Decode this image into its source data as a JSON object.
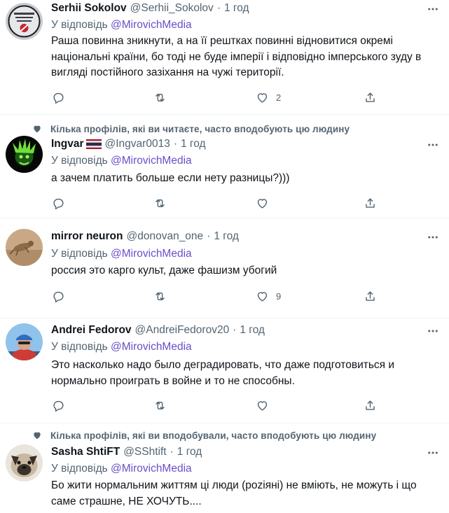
{
  "tweets": [
    {
      "social_context": "",
      "name": "Serhii Sokolov",
      "handle": "@Serhii_Sokolov",
      "time": "1 год",
      "reply_prefix": "У відповідь",
      "reply_mention": "@MirovichMedia",
      "text": "Раша повинна зникнути, а на її рештках повинні відновитися окремі національні країни, бо тоді не буде імперії і відповідно імперського зуду в вигляді постійного зазіхання на чужі території.",
      "reply_count": "",
      "retweet_count": "",
      "like_count": "2",
      "avatar_icon": "avatar-serhii"
    },
    {
      "social_context": "Кілька профілів, які ви читаєте, часто вподобують цю людину",
      "name": "Ingvar",
      "handle": "@Ingvar0013",
      "time": "1 год",
      "reply_prefix": "У відповідь",
      "reply_mention": "@MirovichMedia",
      "text": "а зачем платить больше если нету разницы?)))",
      "reply_count": "",
      "retweet_count": "",
      "like_count": "",
      "avatar_icon": "avatar-ingvar",
      "flag_icon": "thai-flag-icon"
    },
    {
      "social_context": "",
      "name": "mirror neuron",
      "handle": "@donovan_one",
      "time": "1 год",
      "reply_prefix": "У відповідь",
      "reply_mention": "@MirovichMedia",
      "text": "россия это карго культ, даже фашизм убогий",
      "reply_count": "",
      "retweet_count": "",
      "like_count": "9",
      "avatar_icon": "avatar-mirror"
    },
    {
      "social_context": "",
      "name": "Andrei Fedorov",
      "handle": "@AndreiFedorov20",
      "time": "1 год",
      "reply_prefix": "У відповідь",
      "reply_mention": "@MirovichMedia",
      "text": "Это насколько надо было деградировать, что даже подготовиться и нормально проиграть в войне и то не способны.",
      "reply_count": "",
      "retweet_count": "",
      "like_count": "",
      "avatar_icon": "avatar-andrei"
    },
    {
      "social_context": "Кілька профілів, які ви вподобували, часто вподобують цю людину",
      "name": "Sasha ShtiFT",
      "handle": "@SShtift",
      "time": "1 год",
      "reply_prefix": "У відповідь",
      "reply_mention": "@MirovichMedia",
      "text": "Бо жити нормальним життям ці люди (роziяні) не вміють, не можуть і що саме страшне, НЕ ХОЧУТЬ....",
      "reply_count": "",
      "retweet_count": "",
      "like_count": "",
      "avatar_icon": "avatar-sasha"
    }
  ],
  "colors": {
    "text": "#0f1419",
    "secondary": "#536471",
    "mention": "#6a4fc7",
    "divider": "#eff3f4"
  }
}
